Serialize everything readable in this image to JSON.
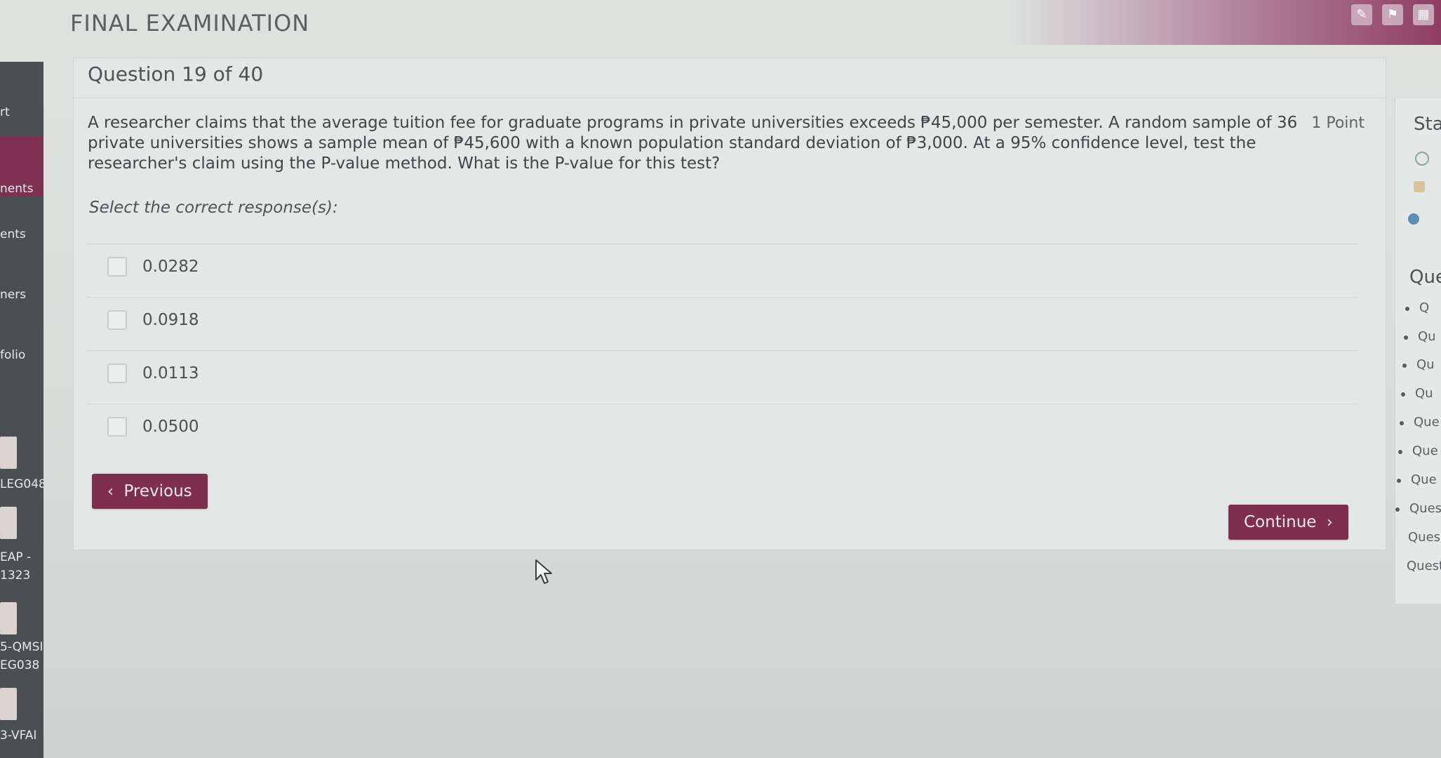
{
  "header": {
    "title": "FINAL EXAMINATION"
  },
  "sidebar": {
    "items": [
      {
        "label": "rt"
      },
      {
        "label": "nents"
      },
      {
        "label": "ents"
      },
      {
        "label": "ners"
      },
      {
        "label": "folio"
      },
      {
        "label": "LEG048"
      },
      {
        "label": "EAP -"
      },
      {
        "label": "1323"
      },
      {
        "label": "5-QMSI"
      },
      {
        "label": "EG038"
      },
      {
        "label": "3-VFAI"
      }
    ]
  },
  "question": {
    "header": "Question 19 of 40",
    "points": "1 Point",
    "text": "A researcher claims that the average tuition fee for graduate programs in private universities exceeds ₱45,000 per semester. A random sample of 36 private universities shows a sample mean of ₱45,600 with a known population standard deviation of ₱3,000. At a 95% confidence level, test the researcher's claim using the P-value method. What is the P-value for this test?",
    "select_label": "Select the correct response(s):",
    "options": [
      {
        "label": "0.0282"
      },
      {
        "label": "0.0918"
      },
      {
        "label": "0.0113"
      },
      {
        "label": "0.0500"
      }
    ]
  },
  "buttons": {
    "previous": "Previous",
    "continue": "Continue"
  },
  "right_panel": {
    "status_title": "Sta",
    "questions_title": "Ques",
    "items": [
      "Q",
      "Qu",
      "Qu",
      "Qu",
      "Que",
      "Que",
      "Que",
      "Ques",
      "Ques",
      "Quest"
    ]
  },
  "colors": {
    "accent": "#7e2f4e",
    "sidebar": "#4a5052",
    "background": "#dfe3e0"
  }
}
